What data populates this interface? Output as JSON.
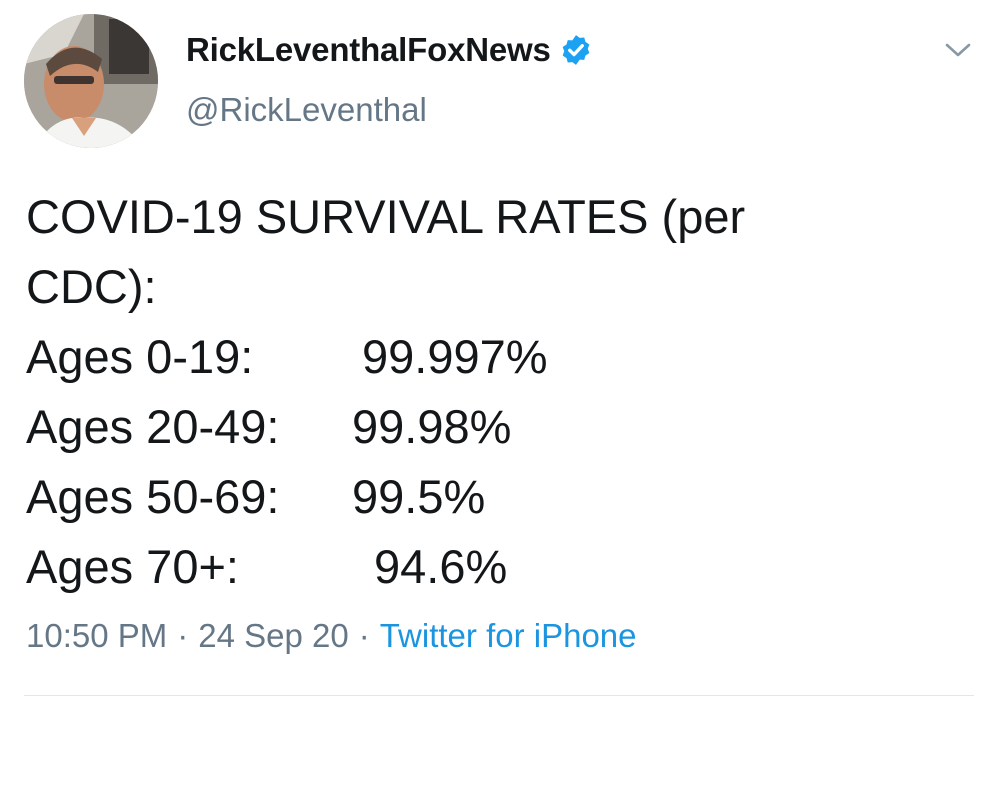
{
  "user": {
    "display_name": "RickLeventhalFoxNews",
    "handle": "@RickLeventhal",
    "verified": true
  },
  "tweet": {
    "lines": [
      "COVID-19 SURVIVAL RATES (per",
      "CDC):"
    ],
    "rates": [
      {
        "label": "Ages 0-19:",
        "value": "99.997%"
      },
      {
        "label": "Ages 20-49:",
        "value": "99.98%"
      },
      {
        "label": "Ages 50-69:",
        "value": "99.5%"
      },
      {
        "label": "Ages 70+:",
        "value": "94.6%"
      }
    ]
  },
  "meta": {
    "time": "10:50 PM",
    "separator": "·",
    "date": "24 Sep 20",
    "source": "Twitter for iPhone"
  },
  "icons": {
    "verified": "verified-badge-icon",
    "more": "chevron-down-icon"
  },
  "colors": {
    "verified_blue": "#1da1f2",
    "link_blue": "#1b95e0",
    "secondary_text": "#657786"
  }
}
